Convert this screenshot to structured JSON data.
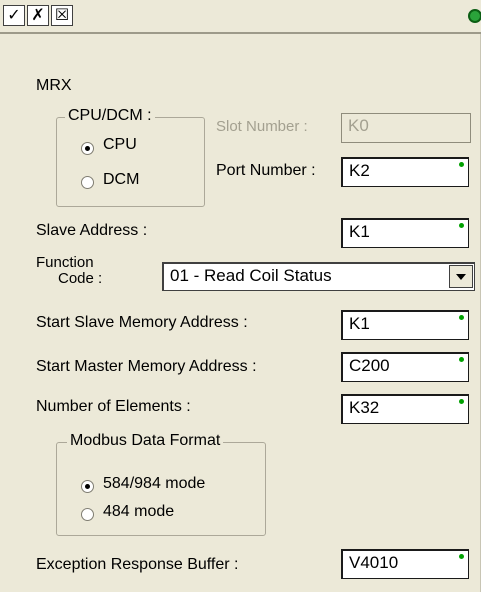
{
  "toolbar": {
    "ok_glyph": "✓",
    "cancel_glyph": "✗",
    "help_glyph": "☒"
  },
  "title": "MRX",
  "cpu_dcm": {
    "group_label": "CPU/DCM :",
    "options": [
      "CPU",
      "DCM"
    ],
    "selected": "CPU"
  },
  "slot_number": {
    "label": "Slot Number :",
    "value": "K0"
  },
  "port_number": {
    "label": "Port Number :",
    "value": "K2"
  },
  "slave_address": {
    "label": "Slave Address :",
    "value": "K1"
  },
  "function_code": {
    "label_line1": "Function",
    "label_line2": "Code :",
    "value": "01 - Read Coil Status"
  },
  "start_slave_memory": {
    "label": "Start Slave Memory Address :",
    "value": "K1"
  },
  "start_master_memory": {
    "label": "Start Master Memory Address :",
    "value": "C200"
  },
  "number_of_elements": {
    "label": "Number of Elements :",
    "value": "K32"
  },
  "modbus_format": {
    "group_label": "Modbus Data Format",
    "options": [
      "584/984 mode",
      "484 mode"
    ],
    "selected": "584/984 mode"
  },
  "exception_buffer": {
    "label": "Exception Response Buffer :",
    "value": "V4010"
  },
  "colors": {
    "panel_bg": "#ece9d8",
    "valid_indicator": "#00a000",
    "status_ok": "#2aa33a"
  }
}
